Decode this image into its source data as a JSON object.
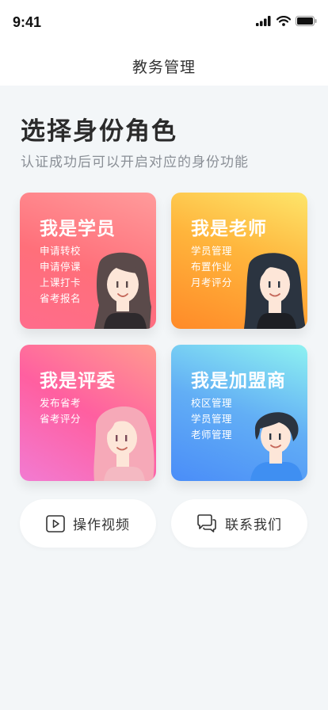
{
  "status_bar": {
    "time": "9:41",
    "icons": [
      "signal-icon",
      "wifi-icon",
      "battery-icon"
    ]
  },
  "nav": {
    "title": "教务管理"
  },
  "heading": {
    "title": "选择身份角色",
    "subtitle": "认证成功后可以开启对应的身份功能"
  },
  "roles": [
    {
      "title": "我是学员",
      "items": [
        "申请转校",
        "申请停课",
        "上课打卡",
        "省考报名"
      ]
    },
    {
      "title": "我是老师",
      "items": [
        "学员管理",
        "布置作业",
        "月考评分"
      ]
    },
    {
      "title": "我是评委",
      "items": [
        "发布省考",
        "省考评分"
      ]
    },
    {
      "title": "我是加盟商",
      "items": [
        "校区管理",
        "学员管理",
        "老师管理"
      ]
    }
  ],
  "actions": [
    {
      "label": "操作视频",
      "icon": "play-video-icon"
    },
    {
      "label": "联系我们",
      "icon": "chat-bubbles-icon"
    }
  ]
}
